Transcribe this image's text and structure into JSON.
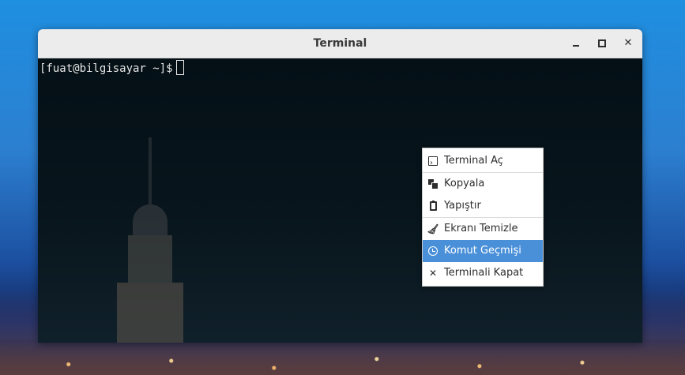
{
  "window": {
    "title": "Terminal"
  },
  "terminal": {
    "prompt": "[fuat@bilgisayar ~]$"
  },
  "context_menu": {
    "items": [
      {
        "label": "Terminal Aç",
        "icon": "terminal-icon"
      },
      {
        "label": "Kopyala",
        "icon": "copy-icon"
      },
      {
        "label": "Yapıştır",
        "icon": "paste-icon"
      },
      {
        "label": "Ekranı Temizle",
        "icon": "broom-icon"
      },
      {
        "label": "Komut Geçmişi",
        "icon": "clock-icon",
        "highlighted": true
      },
      {
        "label": "Terminali Kapat",
        "icon": "close-icon"
      }
    ]
  },
  "colors": {
    "highlight": "#4a90d9",
    "terminal_bg": "#041016",
    "titlebar_bg": "#ececec"
  }
}
